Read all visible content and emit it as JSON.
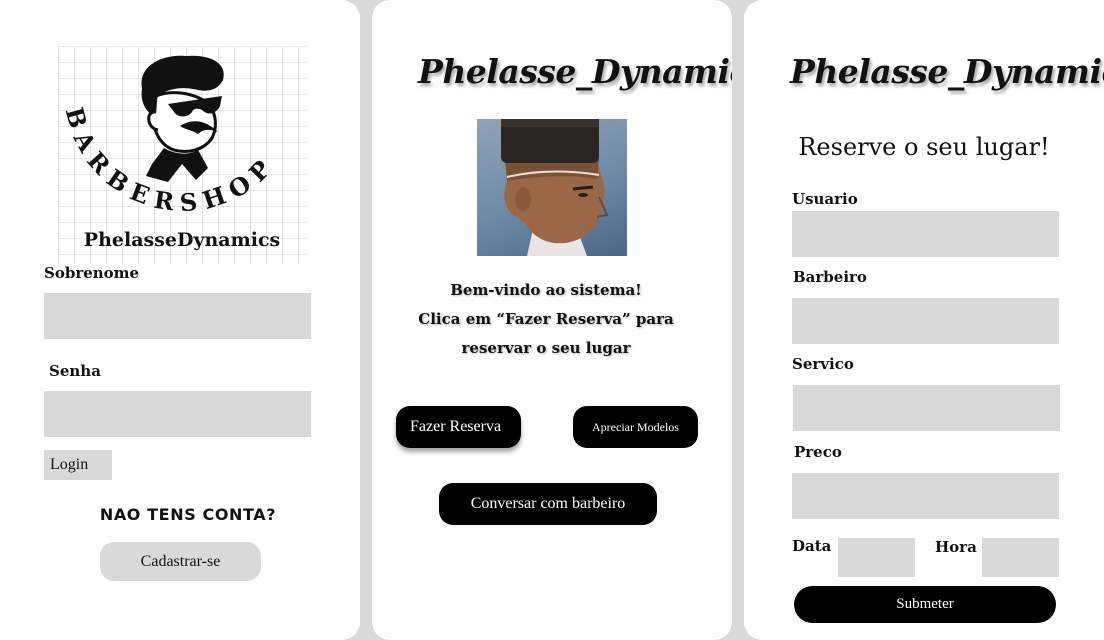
{
  "login_screen": {
    "logo": {
      "arc_text": "BARBERSHOP",
      "name": "PhelasseDynamics"
    },
    "surname_label": "Sobrenome",
    "surname_value": "",
    "password_label": "Senha",
    "password_value": "",
    "login_label": "Login",
    "no_account_text": "NAO TENS CONTA?",
    "register_label": "Cadastrar-se"
  },
  "home_screen": {
    "brand": "Phelasse_Dynamics",
    "welcome_line1": "Bem-vindo ao sistema!",
    "welcome_line2": "Clica em “Fazer Reserva” para",
    "welcome_line3": "reservar o seu lugar",
    "reserve_button": "Fazer Reserva",
    "models_button": "Apreciar Modelos",
    "chat_button": "Conversar com barbeiro"
  },
  "booking_screen": {
    "brand": "Phelasse_Dynamics",
    "heading": "Reserve o seu lugar!",
    "user_label": "Usuario",
    "barber_label": "Barbeiro",
    "service_label": "Servico",
    "price_label": "Preco",
    "date_label": "Data",
    "time_label": "Hora",
    "submit_label": "Submeter"
  },
  "colors": {
    "background": "#d9d9d9",
    "panel": "#ffffff",
    "field": "#d9d9d9",
    "primary_button": "#000000"
  }
}
